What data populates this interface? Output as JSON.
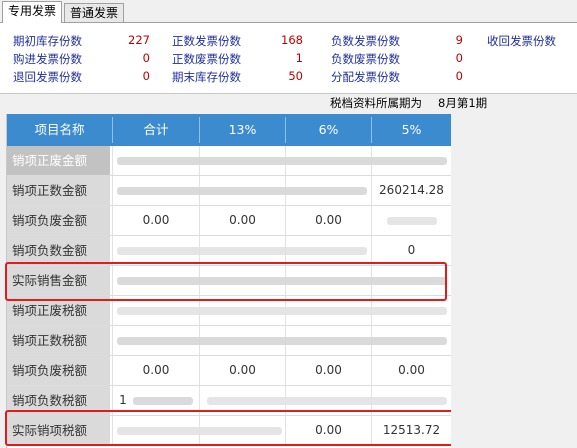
{
  "tabs": [
    {
      "label": "专用发票"
    },
    {
      "label": "普通发票"
    }
  ],
  "stats": {
    "col1": [
      {
        "label": "期初库存份数",
        "value": "227"
      },
      {
        "label": "购进发票份数",
        "value": "0"
      },
      {
        "label": "退回发票份数",
        "value": "0"
      }
    ],
    "col2": [
      {
        "label": "正数发票份数",
        "value": "168"
      },
      {
        "label": "正数废票份数",
        "value": "1"
      },
      {
        "label": "期末库存份数",
        "value": "50"
      }
    ],
    "col3": [
      {
        "label": "负数发票份数",
        "value": "9"
      },
      {
        "label": "负数废票份数",
        "value": "0"
      },
      {
        "label": "分配发票份数",
        "value": "0"
      }
    ],
    "col4": [
      {
        "label": "收回发票份数"
      }
    ]
  },
  "period": {
    "label": "税档资料所属期为",
    "value": "8月第1期"
  },
  "table": {
    "headers": [
      "项目名称",
      "合计",
      "13%",
      "6%",
      "5%"
    ],
    "rows": [
      {
        "label": "销项正废金额",
        "cells": [
          "",
          "",
          "",
          ""
        ]
      },
      {
        "label": "销项正数金额",
        "cells": [
          "",
          "",
          "",
          "260214.28"
        ]
      },
      {
        "label": "销项负废金额",
        "cells": [
          "0.00",
          "0.00",
          "0.00",
          ""
        ]
      },
      {
        "label": "销项负数金额",
        "cells": [
          "",
          "",
          "",
          "0"
        ]
      },
      {
        "label": "实际销售金额",
        "cells": [
          "",
          "",
          "",
          ""
        ]
      },
      {
        "label": "销项正废税额",
        "cells": [
          "",
          "",
          "",
          ""
        ]
      },
      {
        "label": "销项正数税额",
        "cells": [
          "",
          "",
          "",
          ""
        ]
      },
      {
        "label": "销项负废税额",
        "cells": [
          "0.00",
          "0.00",
          "0.00",
          "0.00"
        ]
      },
      {
        "label": "销项负数税额",
        "cells": [
          "1",
          "",
          "",
          ""
        ]
      },
      {
        "label": "实际销项税额",
        "cells": [
          "",
          "",
          "0.00",
          "12513.72"
        ]
      }
    ]
  },
  "colors": {
    "header_bg": "#3d8bcf",
    "label_blue": "#1f2f9c",
    "value_red": "#c00000",
    "highlight": "#e41b1b"
  }
}
